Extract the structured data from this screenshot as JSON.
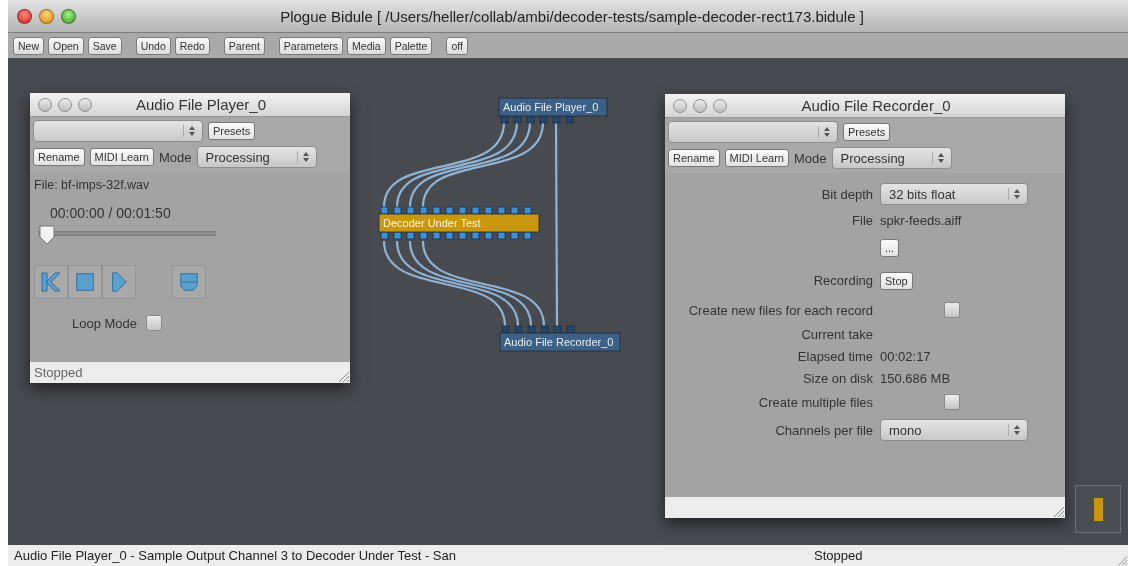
{
  "window": {
    "title": "Plogue Bidule [ /Users/heller/collab/ambi/decoder-tests/sample-decoder-rect173.bidule ]"
  },
  "toolbar": [
    [
      "New",
      "Open",
      "Save"
    ],
    [
      "Undo",
      "Redo"
    ],
    [
      "Parent"
    ],
    [
      "Parameters",
      "Media",
      "Palette"
    ],
    [
      "off"
    ]
  ],
  "player": {
    "title": "Audio File Player_0",
    "presets": "Presets",
    "rename": "Rename",
    "midi_learn": "MIDI Learn",
    "mode_label": "Mode",
    "mode": "Processing",
    "file": "File: bf-imps-32f.wav",
    "time": "00:00:00 / 00:01:50",
    "position": {
      "level": 0
    },
    "loop": {
      "label": "Loop Mode",
      "checked": false
    },
    "status": "Stopped"
  },
  "graph": {
    "nodes": [
      {
        "label": "Audio File Player_0",
        "kind": "module"
      },
      {
        "label": "Decoder Under Test",
        "kind": "highlighted"
      },
      {
        "label": "Audio File Recorder_0",
        "kind": "module"
      }
    ]
  },
  "recorder": {
    "title": "Audio File Recorder_0",
    "presets": "Presets",
    "rename": "Rename",
    "midi_learn": "MIDI Learn",
    "mode_label": "Mode",
    "mode": "Processing",
    "rows": [
      {
        "kind": "select",
        "label": "Bit depth",
        "value": "32 bits float"
      },
      {
        "kind": "text",
        "label": "File",
        "value": "spkr-feeds.aiff"
      },
      {
        "kind": "button",
        "value": "..."
      },
      {
        "kind": "button",
        "label": "Recording",
        "value": "Stop"
      },
      {
        "kind": "checkbox",
        "label": "Create new files for each record",
        "checked": false
      },
      {
        "kind": "text",
        "label": "Current take"
      },
      {
        "kind": "text",
        "label": "Elapsed time",
        "value": "00:02:17"
      },
      {
        "kind": "text",
        "label": "Size on disk",
        "value": "150.686 MB"
      },
      {
        "kind": "checkbox",
        "label": "Create multiple files",
        "checked": false
      },
      {
        "kind": "select",
        "label": "Channels per file",
        "value": "mono"
      }
    ]
  },
  "status_bar": {
    "message": "Audio File Player_0 - Sample Output Channel 3 to Decoder Under Test - San",
    "state": "Stopped"
  }
}
